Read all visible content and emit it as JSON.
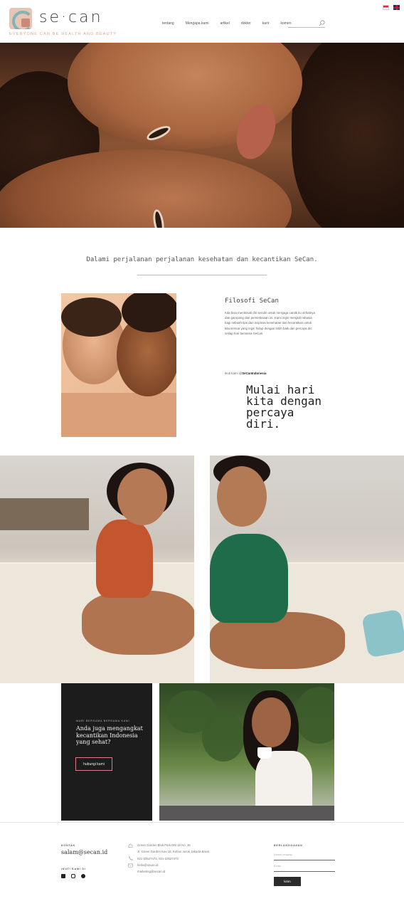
{
  "header": {
    "brand": "se·can",
    "tagline": "EVERYONE CAN BE HEALTH AND BEAUTY",
    "nav": [
      "tentang",
      "Mengapa kami",
      "artikel",
      "dokter",
      "karir",
      "komen"
    ],
    "search_placeholder": "",
    "languages": [
      "Indonesia",
      "English"
    ]
  },
  "intro": {
    "text": "Dalami perjalanan perjalanan kesehatan dan kecantikan SeCan."
  },
  "philosophy": {
    "title": "Filosofi SeCan",
    "body": "Kita bisa menikmati diri sendiri untuk menjaga cantik itu sehatnya dan gampang dari pemeriksaan ini. Kami ingin menjadi rahasia bagi sebuah tips dan inspirasi kesehatan dan kecantikan untuk kita semua yang ingin hidup dengan lebih baik dan percaya diri setiap hari bersama SeCan.",
    "insta_prefix": "Ikuti kami @",
    "insta_handle": "SeCanIndonesia",
    "motto": "Mulai hari kita dengan percaya diri."
  },
  "cta": {
    "small_label": "MARI BERSAMA BERSAMA KAMI",
    "heading": "Anda juga mengangkat kecantikan Indonesia yang sehat?",
    "button": "hubungi kami"
  },
  "footer": {
    "contact_label": "KONTAK",
    "email_big": "salam@secan.id",
    "follow_label": "IKUTI KAMI DI",
    "socials": [
      "email-icon",
      "instagram-icon",
      "twitter-icon"
    ],
    "address_1": "Green Garden Blok Park DM 18 No. 36",
    "address_2": "Jl. Green Garden Kav 18, Kebon Jeruk Jakarta Barat",
    "phone": "021-22527472, 021-22527473",
    "email_1": "hello@secan.id",
    "email_2": "marketing@secan.id",
    "newsletter_label": "BERLANGGANAN",
    "name_placeholder": "Nama Lengkap",
    "email_placeholder": "Email",
    "submit": "kirim"
  },
  "colors": {
    "accent": "#d8a896",
    "dark_panel": "#1c1c1c",
    "button_border": "#e07a86"
  }
}
